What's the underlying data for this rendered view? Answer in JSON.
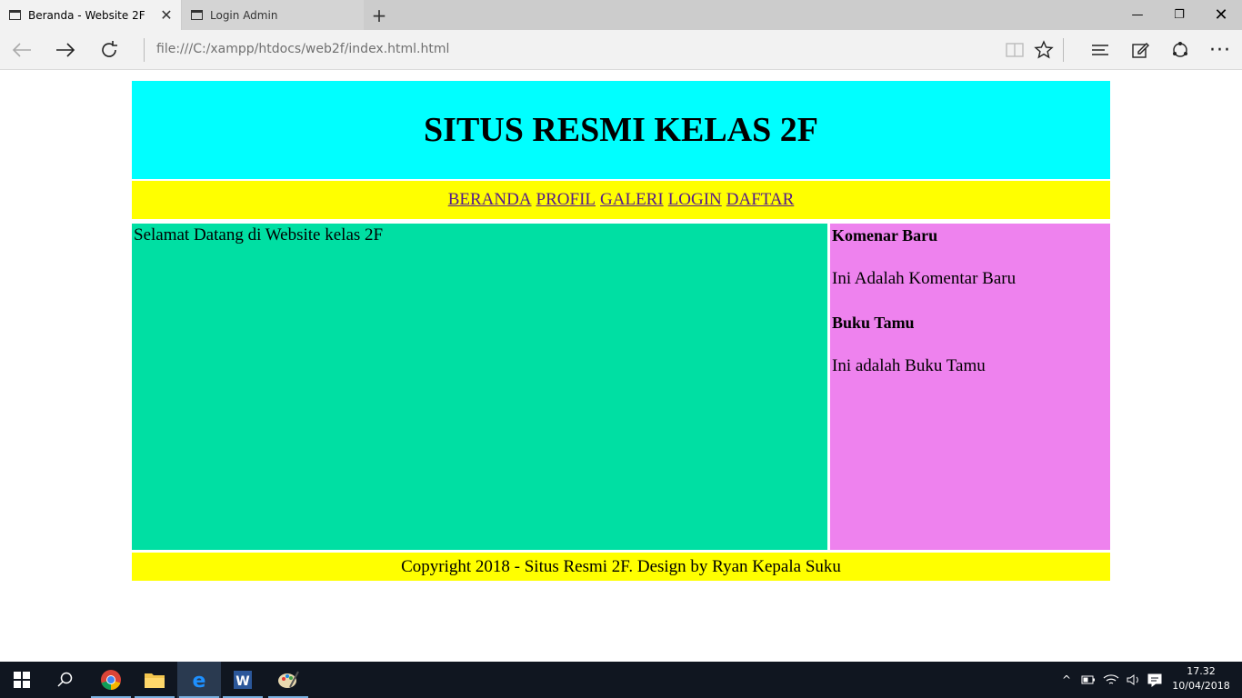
{
  "browser": {
    "tabs": [
      {
        "label": "Beranda - Website 2F",
        "active": true
      },
      {
        "label": "Login Admin",
        "active": false
      }
    ],
    "new_tab_label": "+",
    "address": "file:///C:/xampp/htdocs/web2f/index.html.html",
    "icons": {
      "back": "back-arrow-icon",
      "forward": "forward-arrow-icon",
      "refresh": "refresh-icon",
      "reading_view": "reading-view-icon",
      "favorite": "star-icon",
      "hub": "hub-icon",
      "notes": "web-note-icon",
      "share": "share-icon",
      "more": "more-icon"
    }
  },
  "site": {
    "title": "SITUS RESMI KELAS 2F",
    "menu": [
      "BERANDA",
      "PROFIL",
      "GALERI",
      "LOGIN",
      "DAFTAR"
    ],
    "welcome": "Selamat Datang di Website kelas 2F",
    "sidebar": {
      "heading1": "Komenar Baru",
      "text1": "Ini Adalah Komentar Baru",
      "heading2": "Buku Tamu",
      "text2": "Ini adalah Buku Tamu"
    },
    "footer": "Copyright 2018 - Situs Resmi 2F. Design by Ryan Kepala Suku",
    "colors": {
      "header": "#00ffff",
      "menu": "#ffff00",
      "content": "#00dfa3",
      "sidebar": "#ee82ee",
      "footer": "#ffff00",
      "link": "#551a8b"
    }
  },
  "taskbar": {
    "time": "17.32",
    "date": "10/04/2018",
    "apps": [
      "start-icon",
      "search-icon",
      "chrome-icon",
      "file-explorer-icon",
      "edge-icon",
      "word-icon",
      "paint-icon"
    ]
  }
}
